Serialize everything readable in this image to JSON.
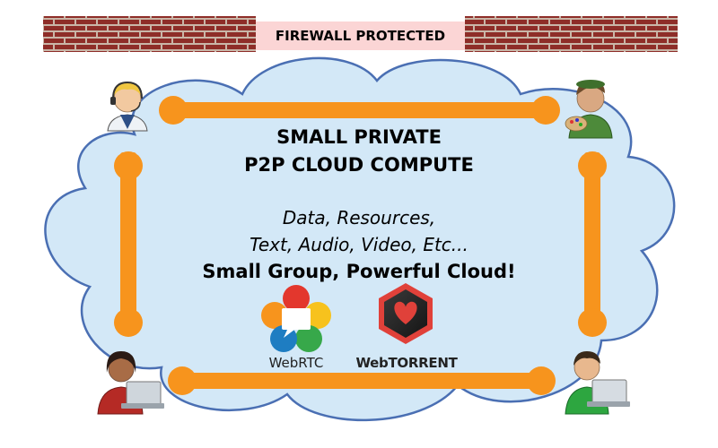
{
  "firewall": {
    "label": "FIREWALL PROTECTED"
  },
  "cloud": {
    "title_line1": "SMALL PRIVATE",
    "title_line2": "P2P CLOUD COMPUTE",
    "subtitle_line1": "Data, Resources,",
    "subtitle_line2": "Text, Audio, Video, Etc...",
    "tagline": "Small Group, Powerful Cloud!"
  },
  "logos": {
    "webrtc": "WebRTC",
    "webtorrent": "WebTORRENT"
  },
  "nodes": [
    {
      "name": "headset-user-icon"
    },
    {
      "name": "painter-user-icon"
    },
    {
      "name": "laptop-user-female-icon"
    },
    {
      "name": "laptop-user-male-icon"
    }
  ],
  "colors": {
    "brick": "#8e2d28",
    "mortar": "#c9b6a8",
    "firewall_label_bg": "#fbd5d5",
    "cloud_fill": "#d3e8f7",
    "cloud_stroke": "#4a6fb3",
    "link": "#f7941d"
  }
}
